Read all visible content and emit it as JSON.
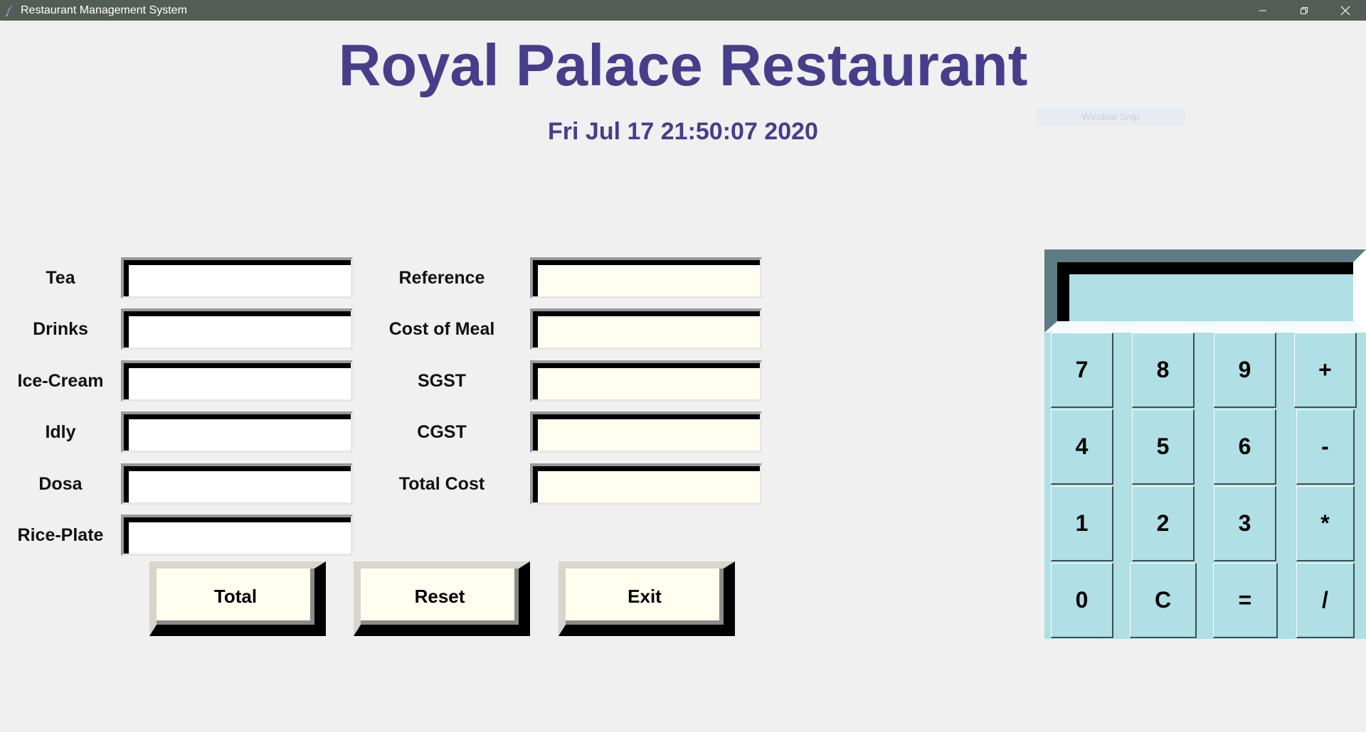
{
  "window": {
    "title": "Restaurant Management System",
    "snip_overlay": "Window Snip"
  },
  "header": {
    "title": "Royal Palace Restaurant",
    "datetime": "Fri Jul 17 21:50:07 2020"
  },
  "items": [
    {
      "label": "Tea",
      "value": ""
    },
    {
      "label": "Drinks",
      "value": ""
    },
    {
      "label": "Ice-Cream",
      "value": ""
    },
    {
      "label": "Idly",
      "value": ""
    },
    {
      "label": "Dosa",
      "value": ""
    },
    {
      "label": "Rice-Plate",
      "value": ""
    }
  ],
  "costs": [
    {
      "label": "Reference",
      "value": ""
    },
    {
      "label": "Cost of Meal",
      "value": ""
    },
    {
      "label": "SGST",
      "value": ""
    },
    {
      "label": "CGST",
      "value": ""
    },
    {
      "label": "Total Cost",
      "value": ""
    }
  ],
  "buttons": {
    "total": "Total",
    "reset": "Reset",
    "exit": "Exit"
  },
  "calculator": {
    "display": "",
    "keys": [
      "7",
      "8",
      "9",
      "+",
      "4",
      "5",
      "6",
      "-",
      "1",
      "2",
      "3",
      "*",
      "0",
      "C",
      "=",
      "/"
    ]
  },
  "colors": {
    "accent": "#483d8b",
    "calc_bg": "#b0dfe5",
    "entry_bg": "#fffff0"
  }
}
